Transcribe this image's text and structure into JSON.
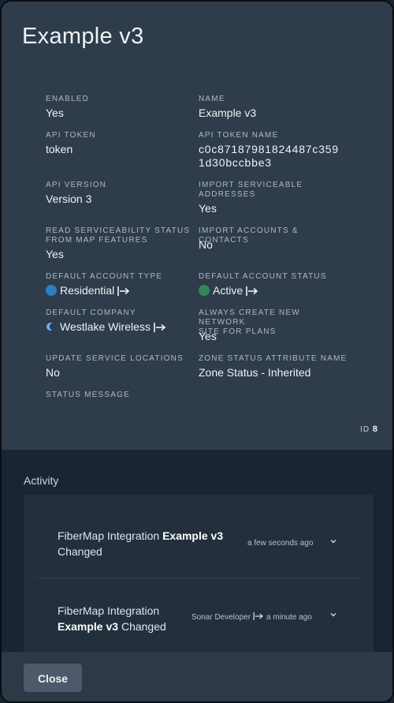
{
  "title": "Example v3",
  "fields": {
    "enabled": {
      "label": "ENABLED",
      "value": "Yes"
    },
    "name": {
      "label": "NAME",
      "value": "Example v3"
    },
    "api_token": {
      "label": "API TOKEN",
      "value": "token"
    },
    "api_token_name": {
      "label": "API TOKEN NAME",
      "value_line1": "c0c87187981824487c359",
      "value_line2": "1d30bccbbe3"
    },
    "api_version": {
      "label": "API VERSION",
      "value": "Version 3"
    },
    "import_serviceable": {
      "label_line1": "IMPORT SERVICEABLE",
      "label_line2": "ADDRESSES",
      "value": "Yes"
    },
    "read_serviceability": {
      "label_line1": "READ SERVICEABILITY STATUS",
      "label_line2": "FROM MAP FEATURES",
      "value": "Yes"
    },
    "import_accounts": {
      "label": "IMPORT ACCOUNTS & CONTACTS",
      "value": "No"
    },
    "default_account_type": {
      "label": "DEFAULT ACCOUNT TYPE",
      "value": "Residential",
      "dot_color": "#2e7fc0"
    },
    "default_account_status": {
      "label": "DEFAULT ACCOUNT STATUS",
      "value": "Active",
      "dot_color": "#2f8a5a"
    },
    "default_company": {
      "label": "DEFAULT COMPANY",
      "value": "Westlake Wireless",
      "icon": "moon-icon"
    },
    "always_create": {
      "label_line1": "ALWAYS CREATE NEW NETWORK",
      "label_line2": "SITE FOR PLANS",
      "value": "Yes"
    },
    "update_service_locations": {
      "label": "UPDATE SERVICE LOCATIONS",
      "value": "No"
    },
    "zone_status": {
      "label": "ZONE STATUS ATTRIBUTE NAME",
      "value": "Zone Status - Inherited"
    },
    "status_message": {
      "label": "STATUS MESSAGE",
      "value": ""
    }
  },
  "id": {
    "label": "ID",
    "value": "8"
  },
  "activity": {
    "title": "Activity",
    "items": [
      {
        "prefix": "FiberMap Integration",
        "name": "Example v3",
        "suffix": "Changed",
        "actor": "",
        "time": "a few seconds ago"
      },
      {
        "prefix": "FiberMap Integration",
        "name": "Example v3",
        "suffix": "Changed",
        "actor": "Sonar Developer",
        "time": "a minute ago"
      }
    ]
  },
  "footer": {
    "close_label": "Close"
  }
}
